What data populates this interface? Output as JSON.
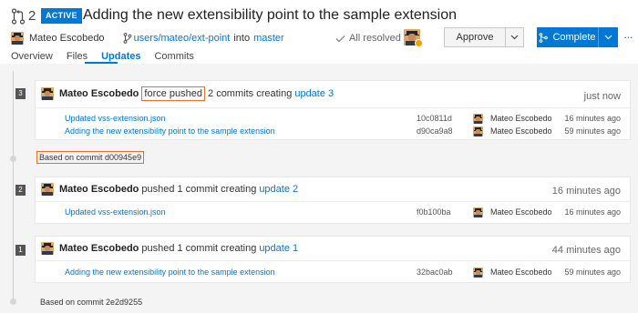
{
  "header": {
    "pr_number": "2",
    "status_badge": "ACTIVE",
    "title": "Adding the new extensibility point to the sample extension",
    "author": "Mateo Escobedo",
    "source_branch": "users/mateo/ext-point",
    "into_label": "into",
    "target_branch": "master",
    "resolved_label": "All resolved",
    "approve_label": "Approve",
    "complete_label": "Complete",
    "more_label": "···"
  },
  "tabs": [
    {
      "label": "Overview"
    },
    {
      "label": "Files"
    },
    {
      "label": "Updates"
    },
    {
      "label": "Commits"
    }
  ],
  "updates": [
    {
      "number": "3",
      "author": "Mateo Escobedo",
      "action": "force pushed",
      "summary": "2 commits creating",
      "update_link": "update 3",
      "time": "just now",
      "commits": [
        {
          "message": "Updated vss-extension.json",
          "sha": "10c0811d",
          "author": "Mateo Escobedo",
          "ago": "16 minutes ago"
        },
        {
          "message": "Adding the new extensibility point to the sample extension",
          "sha": "d90ca9a8",
          "author": "Mateo Escobedo",
          "ago": "59 minutes ago"
        }
      ],
      "based_on": "Based on commit d00945e9"
    },
    {
      "number": "2",
      "author": "Mateo Escobedo",
      "action": "pushed",
      "summary": "1 commit creating",
      "update_link": "update 2",
      "time": "16 minutes ago",
      "commits": [
        {
          "message": "Updated vss-extension.json",
          "sha": "f0b100ba",
          "author": "Mateo Escobedo",
          "ago": "16 minutes ago"
        }
      ]
    },
    {
      "number": "1",
      "author": "Mateo Escobedo",
      "action": "pushed",
      "summary": "1 commit creating",
      "update_link": "update 1",
      "time": "44 minutes ago",
      "commits": [
        {
          "message": "Adding the new extensibility point to the sample extension",
          "sha": "32bac0ab",
          "author": "Mateo Escobedo",
          "ago": "59 minutes ago"
        }
      ],
      "based_on": "Based on commit 2e2d9255"
    }
  ],
  "colors": {
    "accent": "#0078d4",
    "highlight": "#e8702a",
    "pending": "#f2a100"
  }
}
